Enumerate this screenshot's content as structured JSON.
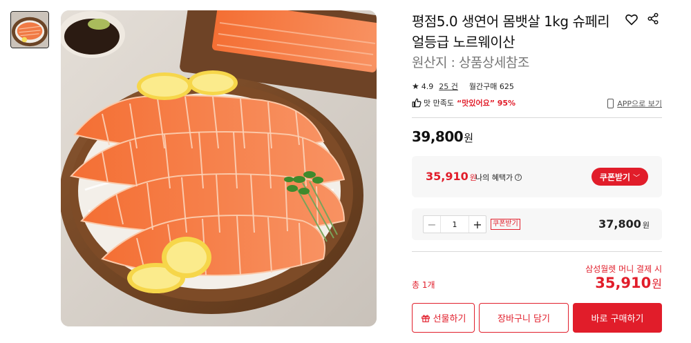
{
  "product": {
    "title": "평점5.0 생연어 몸뱃살 1kg 슈페리얼등급 노르웨이산",
    "origin": "원산지 : 상품상세참조",
    "rating": "4.9",
    "reviews": "25 건",
    "monthly": "월간구매 625",
    "satisfaction_label": "맛 만족도",
    "satisfaction_value": "“맛있어요” 95%",
    "app_link": "APP으로 보기",
    "price": "39,800",
    "currency": "원"
  },
  "benefit": {
    "price": "35,910",
    "currency": "원",
    "label": "나의 혜택가",
    "coupon_button": "쿠폰받기"
  },
  "quantity": {
    "minus": "−",
    "value": "1",
    "plus": "+",
    "coupon_tag": "쿠폰받기",
    "price": "37,800",
    "currency": "원"
  },
  "total": {
    "pay_note": "삼성월렛 머니 결제 시",
    "label": "총 1개",
    "price": "35,910",
    "currency": "원"
  },
  "actions": {
    "gift": "선물하기",
    "cart": "장바구니 담기",
    "buy": "바로 구매하기"
  },
  "colors": {
    "accent": "#e11d2a",
    "panel_bg": "#f7f7f7"
  },
  "icons": [
    "heart-icon",
    "share-icon",
    "star-icon",
    "thumbs-up-icon",
    "phone-icon",
    "question-icon",
    "chevron-down-icon",
    "gift-icon"
  ]
}
